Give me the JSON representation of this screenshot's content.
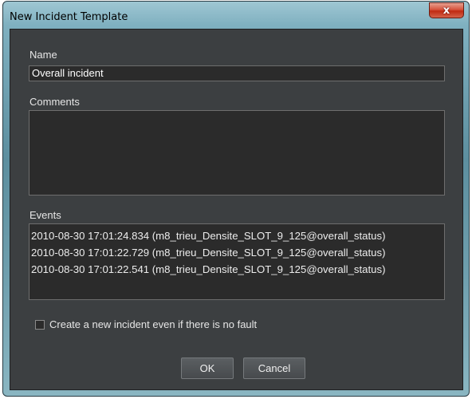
{
  "window": {
    "title": "New Incident Template",
    "close_glyph": "x"
  },
  "name": {
    "label": "Name",
    "value": "Overall incident"
  },
  "comments": {
    "label": "Comments",
    "value": ""
  },
  "events": {
    "label": "Events",
    "items": [
      "2010-08-30 17:01:24.834 (m8_trieu_Densite_SLOT_9_125@overall_status)",
      "2010-08-30 17:01:22.729 (m8_trieu_Densite_SLOT_9_125@overall_status)",
      "2010-08-30 17:01:22.541 (m8_trieu_Densite_SLOT_9_125@overall_status)"
    ]
  },
  "options": {
    "create_new_label": "Create a new incident even if there is no fault",
    "create_new_checked": false
  },
  "buttons": {
    "ok": "OK",
    "cancel": "Cancel"
  }
}
